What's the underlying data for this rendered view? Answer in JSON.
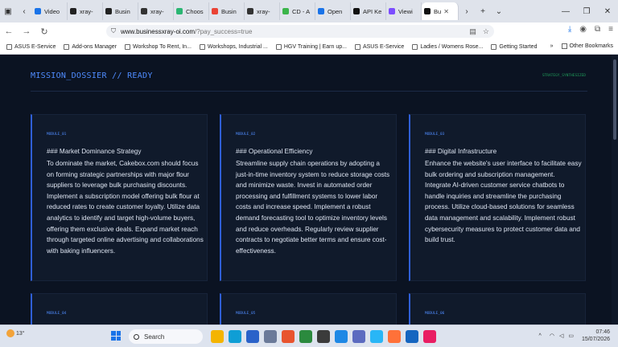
{
  "browser": {
    "tabs": [
      {
        "label": "Video",
        "color": "#1a73e8",
        "active": false
      },
      {
        "label": "xray-",
        "color": "#222222",
        "active": false
      },
      {
        "label": "Busin",
        "color": "#222222",
        "active": false
      },
      {
        "label": "xray-",
        "color": "#333333",
        "active": false
      },
      {
        "label": "Choos",
        "color": "#2bb673",
        "active": false
      },
      {
        "label": "Busin",
        "color": "#ea4335",
        "active": false
      },
      {
        "label": "xray-",
        "color": "#333333",
        "active": false
      },
      {
        "label": "CD - A",
        "color": "#3bb54a",
        "active": false
      },
      {
        "label": "Open",
        "color": "#1a73e8",
        "active": false
      },
      {
        "label": "API Ke",
        "color": "#111111",
        "active": false
      },
      {
        "label": "Viewi",
        "color": "#7c4dff",
        "active": false
      },
      {
        "label": "Bu",
        "color": "#111111",
        "active": true
      }
    ],
    "url_host": "www.businessxray-oi.com",
    "url_path": "/?pay_success=true",
    "bookmarks": [
      "ASUS E-Service",
      "Add-ons Manager",
      "Workshop To Rent, In...",
      "Workshops, Industrial ...",
      "HGV Training | Earn up...",
      "ASUS E-Service",
      "Ladies / Womens Rose...",
      "Getting Started"
    ],
    "other_bookmarks": "Other Bookmarks"
  },
  "page": {
    "header_title": "MISSION_DOSSIER // READY",
    "status_label": "STRATEGY_SYNTHESIZED",
    "cards": [
      {
        "module": "MODULE_01",
        "title": "### Market Dominance Strategy",
        "body": "To dominate the market, Cakebox.com should focus on forming strategic partnerships with major flour suppliers to leverage bulk purchasing discounts. Implement a subscription model offering bulk flour at reduced rates to create customer loyalty. Utilize data analytics to identify and target high-volume buyers, offering them exclusive deals. Expand market reach through targeted online advertising and collaborations with baking influencers."
      },
      {
        "module": "MODULE_02",
        "title": "### Operational Efficiency",
        "body": "Streamline supply chain operations by adopting a just-in-time inventory system to reduce storage costs and minimize waste. Invest in automated order processing and fulfillment systems to lower labor costs and increase speed. Implement a robust demand forecasting tool to optimize inventory levels and reduce overheads. Regularly review supplier contracts to negotiate better terms and ensure cost-effectiveness."
      },
      {
        "module": "MODULE_03",
        "title": "### Digital Infrastructure",
        "body": "Enhance the website's user interface to facilitate easy bulk ordering and subscription management. Integrate AI-driven customer service chatbots to handle inquiries and streamline the purchasing process. Utilize cloud-based solutions for seamless data management and scalability. Implement robust cybersecurity measures to protect customer data and build trust."
      },
      {
        "module": "MODULE_04",
        "title": "",
        "body": ""
      },
      {
        "module": "MODULE_05",
        "title": "",
        "body": ""
      },
      {
        "module": "MODULE_06",
        "title": "",
        "body": ""
      }
    ]
  },
  "taskbar": {
    "temperature": "13°",
    "search_label": "Search",
    "time": "07:46",
    "date": "15/07/2026"
  }
}
